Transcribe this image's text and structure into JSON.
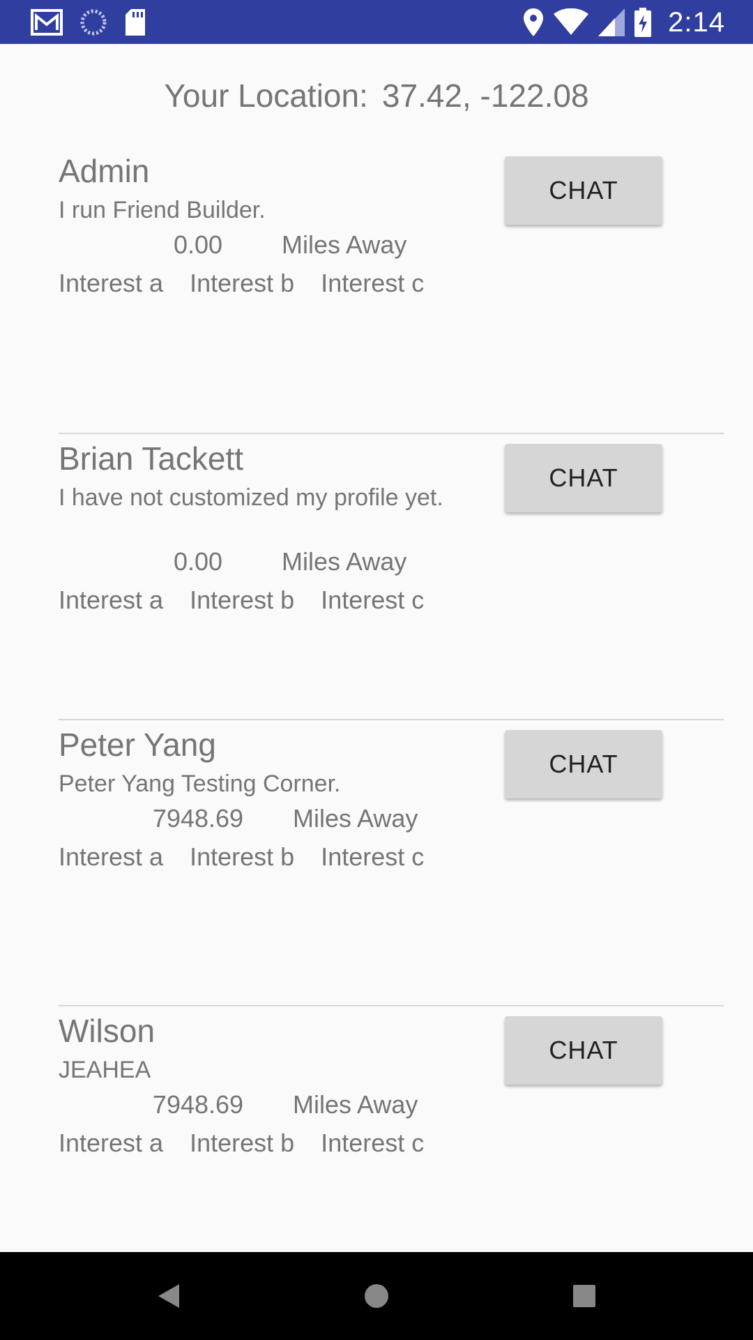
{
  "status_bar": {
    "time": "2:14",
    "left_icons": [
      "gmail-icon",
      "sync-icon",
      "sd-card-icon"
    ],
    "right_icons": [
      "location-icon",
      "wifi-icon",
      "signal-icon",
      "battery-charging-icon"
    ],
    "color": "#303f9f"
  },
  "location": {
    "label": "Your Location:",
    "coords": "37.42, -122.08"
  },
  "users": [
    {
      "name": "Admin",
      "bio": "I run Friend Builder.",
      "distance": "0.00",
      "distance_unit": "Miles Away",
      "interests": [
        "Interest a",
        "Interest b",
        "Interest c"
      ],
      "chat_label": "CHAT"
    },
    {
      "name": "Brian Tackett",
      "bio": "I have not customized my profile yet.",
      "distance": "0.00",
      "distance_unit": "Miles Away",
      "interests": [
        "Interest a",
        "Interest b",
        "Interest c"
      ],
      "chat_label": "CHAT"
    },
    {
      "name": "Peter Yang",
      "bio": "Peter Yang Testing Corner.",
      "distance": "7948.69",
      "distance_unit": "Miles Away",
      "interests": [
        "Interest a",
        "Interest b",
        "Interest c"
      ],
      "chat_label": "CHAT"
    },
    {
      "name": "Wilson",
      "bio": "JEAHEA",
      "distance": "7948.69",
      "distance_unit": "Miles Away",
      "interests": [
        "Interest a",
        "Interest b",
        "Interest c"
      ],
      "chat_label": "CHAT"
    }
  ],
  "nav_bar": {
    "icons": [
      "back-icon",
      "home-icon",
      "recents-icon"
    ]
  }
}
